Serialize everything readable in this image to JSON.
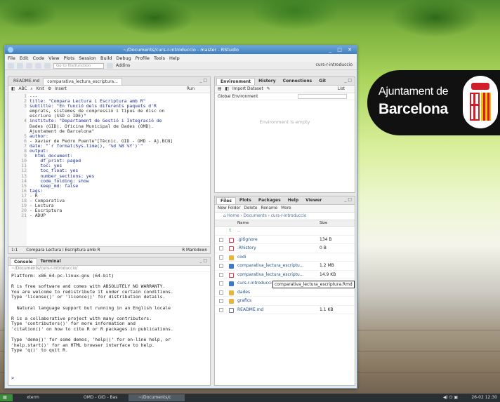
{
  "window": {
    "title": "~/Documents/curs-r-introduccio - master - RStudio"
  },
  "menu": [
    "File",
    "Edit",
    "Code",
    "View",
    "Plots",
    "Session",
    "Build",
    "Debug",
    "Profile",
    "Tools",
    "Help"
  ],
  "toolbar": {
    "goto_file": "Go to file/function",
    "addins": "Addins",
    "project": "curs-r-introduccio"
  },
  "editor": {
    "tabs": [
      "README.md",
      "comparativa_lectura_escriptura..."
    ],
    "tools": {
      "knit": "Knit",
      "insert": "Insert",
      "run": "Run"
    },
    "line_numbers": [
      "1",
      "2",
      "3",
      "",
      "",
      "4",
      "",
      "",
      "5",
      "6",
      "7",
      "8",
      "9",
      "10",
      "11",
      "12",
      "13",
      "14",
      "15",
      "16",
      "17",
      "18",
      "19",
      "20",
      "21"
    ],
    "lines": [
      "---",
      "title: \"Compara Lectura i Escriptura amb R\"",
      "subtitle: \"En funció dels diferents paquets d'R",
      "emprats, sistemes de compressió i tipus de disc on",
      "escriure (SSD o IDE)\"",
      "institute: \"Departament de Gestió i Integració de",
      "Dades (GID). Oficina Municipal de Dades (OMD).",
      "Ajuntament de Barcelona\"",
      "author:",
      "- Xavier de Pedro Puente\"[Tècnic. GID - OMD - Aj.BCN]",
      "date: \"`r format(Sys.time(), '%d %B %Y')`\"",
      "output:",
      "  html_document:",
      "    df_print: paged",
      "    toc: yes",
      "    toc_float: yes",
      "    number_sections: yes",
      "    code_folding: show",
      "    keep_md: false",
      "tags:",
      "- R",
      "- Comparativa",
      "- Lectura",
      "- Escriptura",
      "- ADUP"
    ],
    "status_left": "1:1",
    "status_mid": "Compara Lectura i Escriptura amb R",
    "status_right": "R Markdown"
  },
  "console": {
    "tabs": [
      "Console",
      "Terminal"
    ],
    "path": "~/Documents/curs-r-introduccio/",
    "text": "Platform: x86_64-pc-linux-gnu (64-bit)\n\nR is free software and comes with ABSOLUTELY NO WARRANTY.\nYou are welcome to redistribute it under certain conditions.\nType 'license()' or 'licence()' for distribution details.\n\n  Natural language support but running in an English locale\n\nR is a collaborative project with many contributors.\nType 'contributors()' for more information and\n'citation()' on how to cite R or R packages in publications.\n\nType 'demo()' for some demos, 'help()' for on-line help, or\n'help.start()' for an HTML browser interface to help.\nType 'q()' to quit R.",
    "prompt": ">"
  },
  "env": {
    "tabs": [
      "Environment",
      "History",
      "Connections",
      "Git"
    ],
    "import": "Import Dataset",
    "list": "List",
    "scope": "Global Environment",
    "empty": "Environment is empty"
  },
  "files": {
    "tabs": [
      "Files",
      "Plots",
      "Packages",
      "Help",
      "Viewer"
    ],
    "tools": {
      "new_folder": "New Folder",
      "delete": "Delete",
      "rename": "Rename",
      "more": "More"
    },
    "crumb": {
      "home": "Home",
      "docs": "Documents",
      "proj": "curs-r-introduccio"
    },
    "hdr": {
      "name": "Name",
      "size": "Size"
    },
    "up": "..",
    "rows": [
      {
        "name": ".gitignore",
        "size": "134 B",
        "kind": "rfile"
      },
      {
        "name": ".Rhistory",
        "size": "0 B",
        "kind": "rfile"
      },
      {
        "name": "codi",
        "size": "",
        "kind": "folder"
      },
      {
        "name": "comparativa_lectura_escriptu...",
        "size": "1.2 MB",
        "kind": "htmlf"
      },
      {
        "name": "comparativa_lectura_escriptu...",
        "size": "14.9 KB",
        "kind": "rfile"
      },
      {
        "name": "curs-r-introducci",
        "size": "",
        "kind": "htmlf"
      },
      {
        "name": "dades",
        "size": "",
        "kind": "folder"
      },
      {
        "name": "grafics",
        "size": "",
        "kind": "folder"
      },
      {
        "name": "README.md",
        "size": "1.1 KB",
        "kind": "mdf"
      }
    ]
  },
  "tooltip": "comparativa_lectura_escriptura.Rmd",
  "logo": {
    "line1": "Ajuntament de",
    "line2": "Barcelona"
  },
  "taskbar": {
    "items": [
      "xterm",
      "OMD - GID - Bas",
      "~/Documents/c"
    ],
    "clock": "26-02 12:30"
  }
}
